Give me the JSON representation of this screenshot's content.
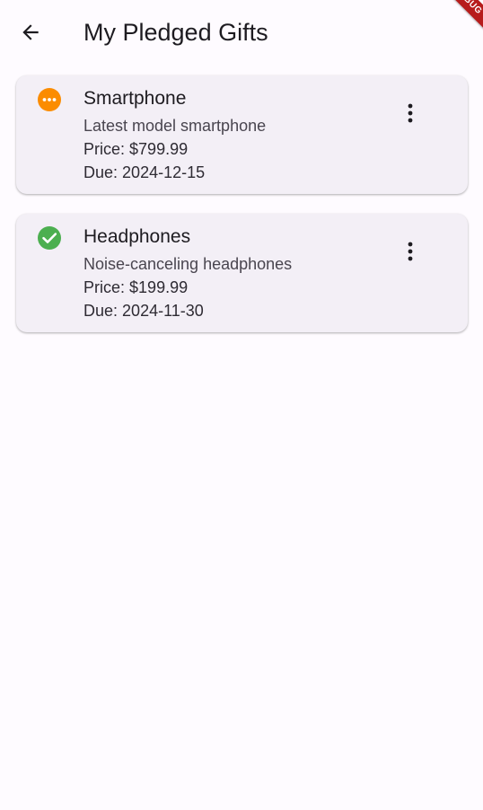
{
  "appbar": {
    "back_icon": "arrow-back-icon",
    "title": "My Pledged Gifts"
  },
  "debug_banner": "DEBUG",
  "gifts": [
    {
      "name": "Smartphone",
      "description": "Latest model smartphone",
      "price_label": "Price:",
      "price": "$799.99",
      "due_label": "Due:",
      "due": "2024-12-15",
      "status_icon": "pending-icon",
      "status_color": "#fb8c00",
      "menu_icon": "more-vert-icon"
    },
    {
      "name": "Headphones",
      "description": "Noise-canceling headphones",
      "price_label": "Price:",
      "price": "$199.99",
      "due_label": "Due:",
      "due": "2024-11-30",
      "status_icon": "check-circle-icon",
      "status_color": "#4caf50",
      "menu_icon": "more-vert-icon"
    }
  ],
  "colors": {
    "background": "#fefbff",
    "card": "#f3eff6",
    "text_primary": "#1d1b20",
    "debug_banner": "#b71c1c"
  }
}
